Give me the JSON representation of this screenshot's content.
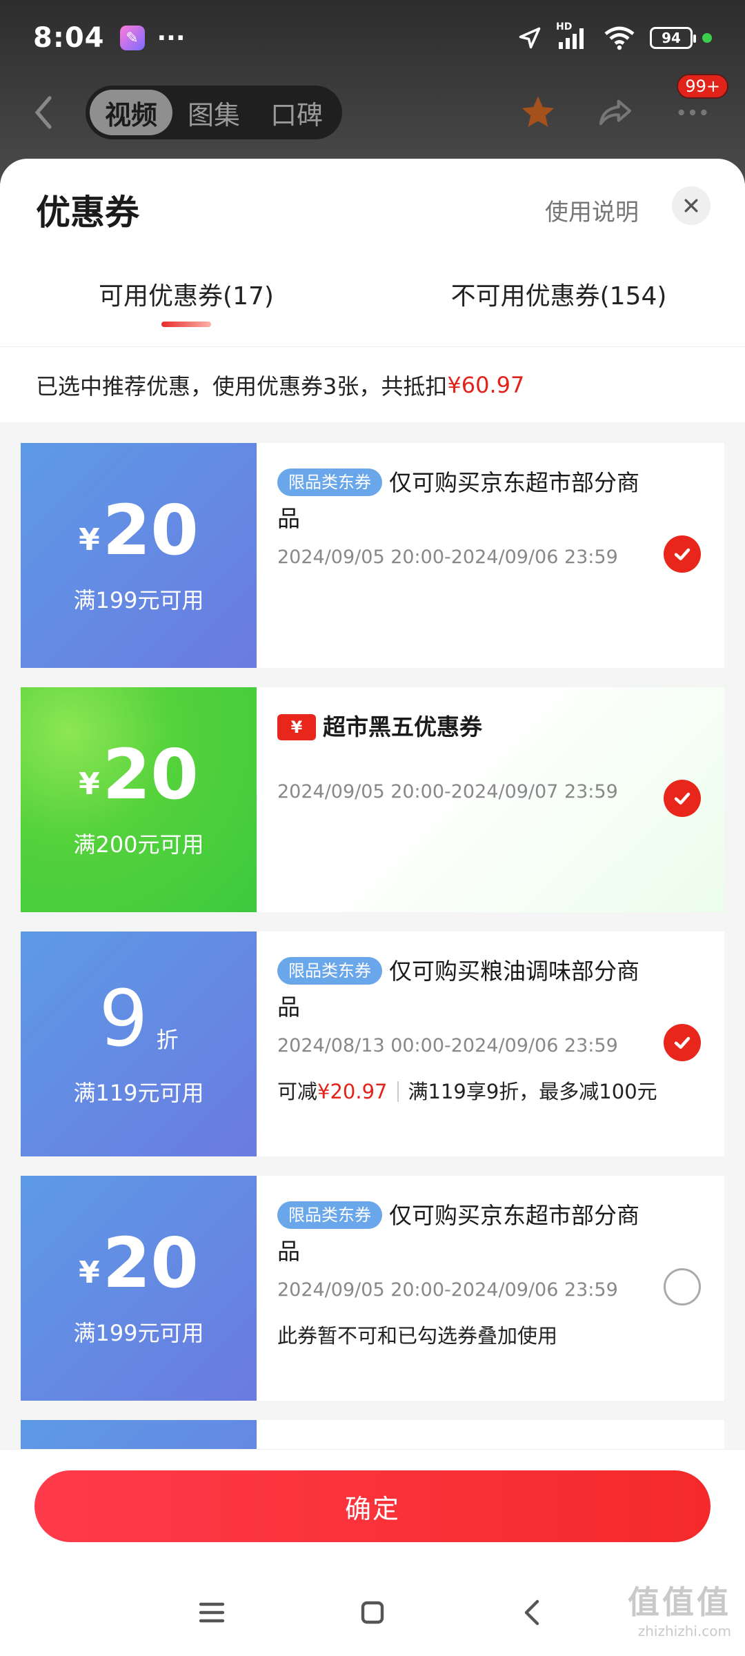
{
  "status_bar": {
    "time": "8:04",
    "app_badge_glyph": "✎",
    "more_dots": "···",
    "network_label": "HD",
    "battery": "94"
  },
  "nav": {
    "tabs": [
      "视频",
      "图集",
      "口碑"
    ],
    "active_tab_index": 0,
    "message_badge": "99+"
  },
  "sheet": {
    "title": "优惠券",
    "help_label": "使用说明",
    "tabs": [
      {
        "label": "可用优惠券(17)",
        "active": true
      },
      {
        "label": "不可用优惠券(154)",
        "active": false
      }
    ],
    "summary_text": "已选中推荐优惠，使用优惠券3张，共抵扣",
    "summary_amount": "¥60.97"
  },
  "coupons": [
    {
      "yen": "¥",
      "value": "20",
      "unit": "",
      "condition": "满199元可用",
      "tag": "限品类东券",
      "title": "仅可购买京东超市部分商品",
      "date": "2024/09/05 20:00-2024/09/06 23:59",
      "checked": true
    },
    {
      "yen": "¥",
      "value": "20",
      "unit": "",
      "condition": "满200元可用",
      "icon_glyph": "¥",
      "title": "超市黑五优惠券",
      "date": "2024/09/05 20:00-2024/09/07 23:59",
      "checked": true
    },
    {
      "yen": "",
      "value": "9",
      "unit": "折",
      "condition": "满119元可用",
      "tag": "限品类东券",
      "title": "仅可购买粮油调味部分商品",
      "date": "2024/08/13 00:00-2024/09/06 23:59",
      "note_prefix": "可减",
      "note_amount": "¥20.97",
      "note_rule": "满119享9折，最多减100元",
      "checked": true
    },
    {
      "yen": "¥",
      "value": "20",
      "unit": "",
      "condition": "满199元可用",
      "tag": "限品类东券",
      "title": "仅可购买京东超市部分商品",
      "date": "2024/09/05 20:00-2024/09/06 23:59",
      "note": "此券暂不可和已勾选券叠加使用",
      "checked": false
    }
  ],
  "footer": {
    "confirm_label": "确定"
  },
  "watermark": {
    "big": "值值值",
    "small": "zhizhizhi.com"
  },
  "colors": {
    "accent_red": "#e2231a",
    "coupon_blue": "#6b8be4",
    "coupon_green": "#4fcf3e",
    "tag_blue": "#6aa6ea"
  }
}
